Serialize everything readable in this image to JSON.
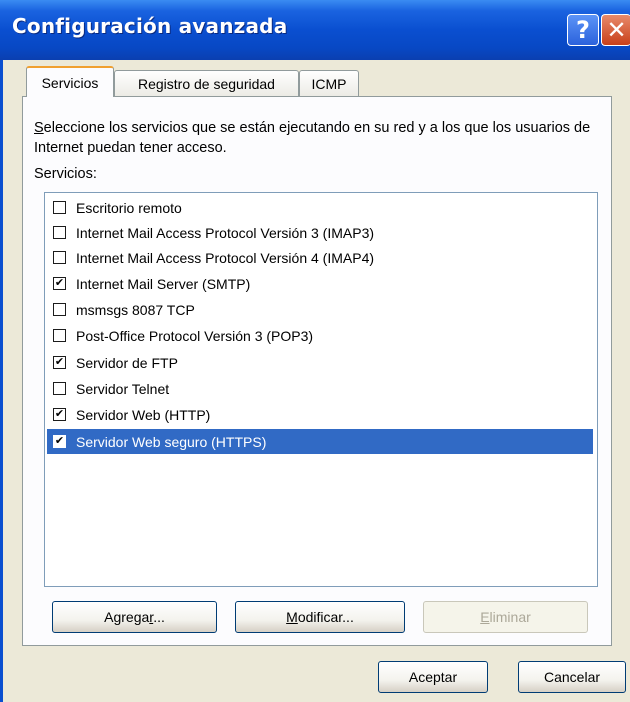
{
  "window": {
    "title": "Configuración avanzada",
    "help_glyph": "?",
    "close_glyph": "✕"
  },
  "tabs": [
    {
      "label": "Servicios",
      "active": true
    },
    {
      "label": "Registro de seguridad",
      "active": false
    },
    {
      "label": "ICMP",
      "active": false
    }
  ],
  "panel": {
    "description_first_letter": "S",
    "description_rest": "eleccione los servicios que se están ejecutando en su red y a los que los usuarios de Internet puedan tener acceso.",
    "list_label": "Servicios:"
  },
  "services": [
    {
      "label": "Escritorio remoto",
      "checked": false,
      "selected": false
    },
    {
      "label": "Internet Mail Access Protocol Versión 3 (IMAP3)",
      "checked": false,
      "selected": false
    },
    {
      "label": "Internet Mail Access Protocol Versión 4 (IMAP4)",
      "checked": false,
      "selected": false
    },
    {
      "label": "Internet Mail Server (SMTP)",
      "checked": true,
      "selected": false
    },
    {
      "label": "msmsgs 8087 TCP",
      "checked": false,
      "selected": false
    },
    {
      "label": "Post-Office Protocol Versión 3 (POP3)",
      "checked": false,
      "selected": false
    },
    {
      "label": "Servidor de FTP",
      "checked": true,
      "selected": false
    },
    {
      "label": "Servidor Telnet",
      "checked": false,
      "selected": false
    },
    {
      "label": "Servidor Web (HTTP)",
      "checked": true,
      "selected": false
    },
    {
      "label": "Servidor Web seguro (HTTPS)",
      "checked": true,
      "selected": true
    }
  ],
  "buttons": {
    "add_pre": "Agrega",
    "add_u": "r",
    "add_post": "...",
    "modify_u": "M",
    "modify_post": "odificar...",
    "delete_u": "E",
    "delete_post": "liminar",
    "ok": "Aceptar",
    "cancel": "Cancelar"
  },
  "colors": {
    "titlebar": "#0a4fd0",
    "selection": "#316ac5",
    "dialog_bg": "#ece9d8"
  }
}
